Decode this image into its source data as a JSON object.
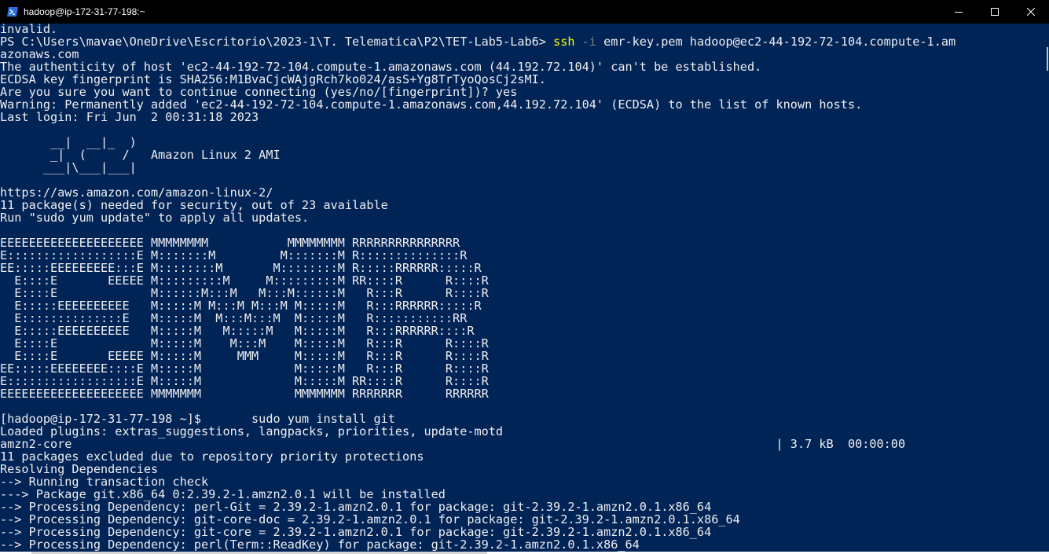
{
  "window": {
    "title": "hadoop@ip-172-31-77-198:~",
    "icon": "powershell-icon"
  },
  "terminal": {
    "lines": [
      {
        "text": "invalid."
      },
      {
        "prompt": "PS C:\\Users\\mavae\\OneDrive\\Escritorio\\2023-1\\T. Telematica\\P2\\TET-Lab5-Lab6> ",
        "cmd": "ssh",
        "param": " -i",
        "rest": " emr-key.pem hadoop@ec2-44-192-72-104.compute-1.am"
      },
      {
        "text": "azonaws.com"
      },
      {
        "text": "The authenticity of host 'ec2-44-192-72-104.compute-1.amazonaws.com (44.192.72.104)' can't be established."
      },
      {
        "text": "ECDSA key fingerprint is SHA256:M1BvaCjcWAjgRch7ko024/asS+Yg8TrTyoQosCj2sMI."
      },
      {
        "text": "Are you sure you want to continue connecting (yes/no/[fingerprint])? yes"
      },
      {
        "text": "Warning: Permanently added 'ec2-44-192-72-104.compute-1.amazonaws.com,44.192.72.104' (ECDSA) to the list of known hosts."
      },
      {
        "text": "Last login: Fri Jun  2 00:31:18 2023"
      },
      {
        "text": ""
      },
      {
        "text": "       __|  __|_  )"
      },
      {
        "text": "       _|  (     /   Amazon Linux 2 AMI"
      },
      {
        "text": "      ___|\\___|___|"
      },
      {
        "text": ""
      },
      {
        "text": "https://aws.amazon.com/amazon-linux-2/"
      },
      {
        "text": "11 package(s) needed for security, out of 23 available"
      },
      {
        "text": "Run \"sudo yum update\" to apply all updates."
      },
      {
        "text": ""
      },
      {
        "text": "EEEEEEEEEEEEEEEEEEEE MMMMMMMM           MMMMMMMM RRRRRRRRRRRRRRR"
      },
      {
        "text": "E::::::::::::::::::E M:::::::M         M:::::::M R::::::::::::::R"
      },
      {
        "text": "EE:::::EEEEEEEEE:::E M::::::::M       M::::::::M R:::::RRRRRR:::::R"
      },
      {
        "text": "  E::::E       EEEEE M:::::::::M     M:::::::::M RR::::R      R::::R"
      },
      {
        "text": "  E::::E             M::::::M:::M   M:::M::::::M   R:::R      R::::R"
      },
      {
        "text": "  E:::::EEEEEEEEEE   M:::::M M:::M M:::M M:::::M   R:::RRRRRR:::::R"
      },
      {
        "text": "  E::::::::::::::E   M:::::M  M:::M:::M  M:::::M   R:::::::::::RR"
      },
      {
        "text": "  E:::::EEEEEEEEEE   M:::::M   M:::::M   M:::::M   R:::RRRRRR::::R"
      },
      {
        "text": "  E::::E             M:::::M    M:::M    M:::::M   R:::R      R::::R"
      },
      {
        "text": "  E::::E       EEEEE M:::::M     MMM     M:::::M   R:::R      R::::R"
      },
      {
        "text": "EE:::::EEEEEEEE::::E M:::::M             M:::::M   R:::R      R::::R"
      },
      {
        "text": "E::::::::::::::::::E M:::::M             M:::::M RR::::R      R::::R"
      },
      {
        "text": "EEEEEEEEEEEEEEEEEEEE MMMMMMM             MMMMMMM RRRRRRR      RRRRRR"
      },
      {
        "text": ""
      },
      {
        "text": "[hadoop@ip-172-31-77-198 ~]$       sudo yum install git"
      },
      {
        "text": "Loaded plugins: extras_suggestions, langpacks, priorities, update-motd"
      },
      {
        "text": "amzn2-core                                                                                                  | 3.7 kB  00:00:00"
      },
      {
        "text": "11 packages excluded due to repository priority protections"
      },
      {
        "text": "Resolving Dependencies"
      },
      {
        "text": "--> Running transaction check"
      },
      {
        "text": "---> Package git.x86_64 0:2.39.2-1.amzn2.0.1 will be installed"
      },
      {
        "text": "--> Processing Dependency: perl-Git = 2.39.2-1.amzn2.0.1 for package: git-2.39.2-1.amzn2.0.1.x86_64"
      },
      {
        "text": "--> Processing Dependency: git-core-doc = 2.39.2-1.amzn2.0.1 for package: git-2.39.2-1.amzn2.0.1.x86_64"
      },
      {
        "text": "--> Processing Dependency: git-core = 2.39.2-1.amzn2.0.1 for package: git-2.39.2-1.amzn2.0.1.x86_64"
      },
      {
        "text": "--> Processing Dependency: perl(Term::ReadKey) for package: git-2.39.2-1.amzn2.0.1.x86_64"
      }
    ]
  },
  "colors": {
    "background": "#012456",
    "foreground": "#eeedf0",
    "command": "#ffff00",
    "parameter": "#808080",
    "titlebar": "#000000"
  }
}
